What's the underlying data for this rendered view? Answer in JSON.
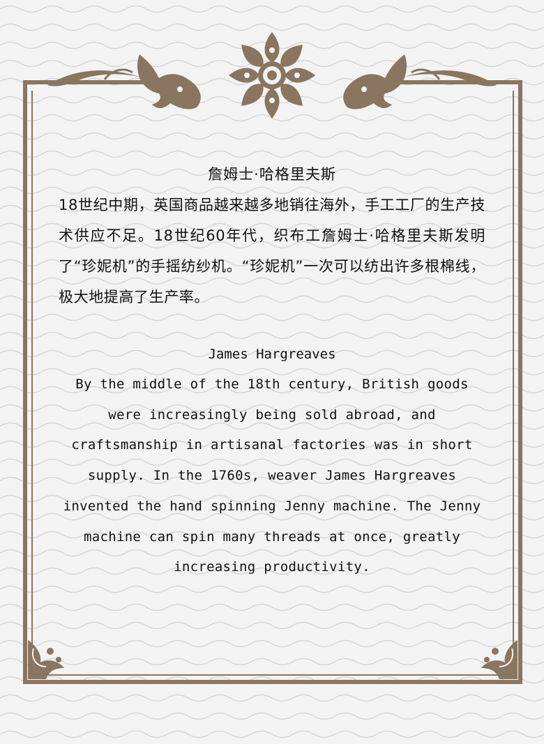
{
  "chinese": {
    "title": "詹姆士·哈格里夫斯",
    "body": "18世纪中期，英国商品越来越多地销往海外，手工工厂的生产技术供应不足。18世纪60年代，织布工詹姆士·哈格里夫斯发明了“珍妮机”的手摇纺纱机。“珍妮机”一次可以纺出许多根棉线，极大地提高了生产率。"
  },
  "english": {
    "title": "James Hargreaves",
    "body": "By the middle of the 18th century, British goods were increasingly being sold abroad, and craftsmanship in artisanal factories was in short supply. In the 1760s, weaver James Hargreaves invented the hand spinning Jenny machine. The Jenny machine can spin many threads at once, greatly increasing productivity."
  },
  "colors": {
    "frame": "#8a7560",
    "background": "#f3f3f3",
    "wave": "#d8d8d8",
    "text": "#111111"
  }
}
